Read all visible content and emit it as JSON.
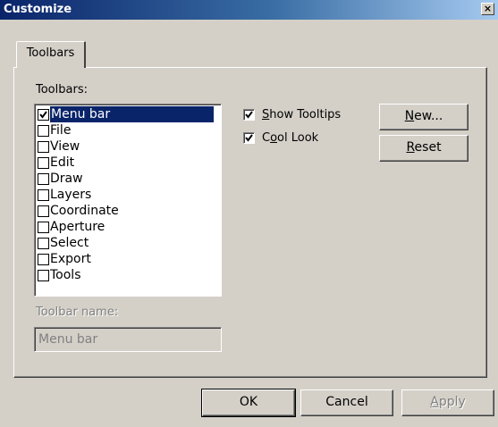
{
  "window": {
    "title": "Customize",
    "close_glyph": "×"
  },
  "tabs": [
    {
      "label": "Toolbars"
    }
  ],
  "toolbars_section": {
    "label": "Toolbars:",
    "items": [
      {
        "label": "Menu bar",
        "checked": true,
        "selected": true
      },
      {
        "label": "File",
        "checked": false
      },
      {
        "label": "View",
        "checked": false
      },
      {
        "label": "Edit",
        "checked": false
      },
      {
        "label": "Draw",
        "checked": false
      },
      {
        "label": "Layers",
        "checked": false
      },
      {
        "label": "Coordinate",
        "checked": false
      },
      {
        "label": "Aperture",
        "checked": false
      },
      {
        "label": "Select",
        "checked": false
      },
      {
        "label": "Export",
        "checked": false
      },
      {
        "label": "Tools",
        "checked": false
      }
    ]
  },
  "options": {
    "show_tooltips": {
      "mnemonic": "S",
      "rest": "how Tooltips",
      "checked": true
    },
    "cool_look": {
      "prefix": "C",
      "mnemonic": "o",
      "rest": "ol Look",
      "checked": true
    }
  },
  "side_buttons": {
    "new": {
      "mnemonic": "N",
      "rest": "ew..."
    },
    "reset": {
      "mnemonic": "R",
      "rest": "eset"
    }
  },
  "toolbar_name": {
    "label": "Toolbar name:",
    "value": "Menu bar"
  },
  "footer": {
    "ok": "OK",
    "cancel": "Cancel",
    "apply": {
      "mnemonic": "A",
      "rest": "pply",
      "enabled": false
    }
  }
}
